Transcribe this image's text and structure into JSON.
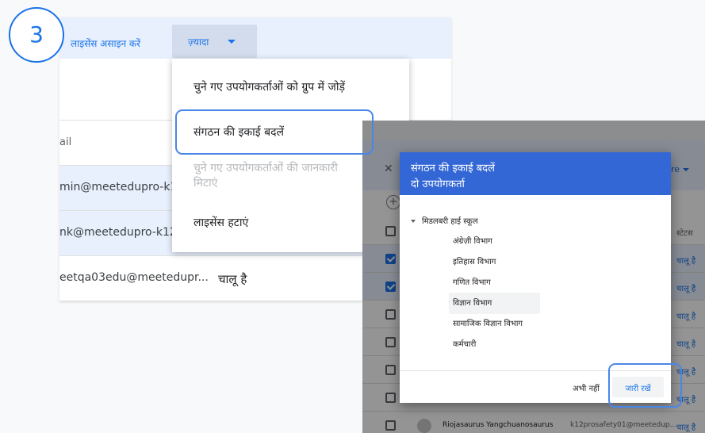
{
  "step": {
    "number": "3"
  },
  "toolbar": {
    "assign_license": "लाइसेंस असाइन करें",
    "more_label": "ज़्यादा"
  },
  "table": {
    "header_email": "ail",
    "rows": [
      {
        "email": "min@meetedupro-k12",
        "status": "",
        "selected": true
      },
      {
        "email": "nk@meetedupro-k12-",
        "status": "",
        "selected": true
      },
      {
        "email": "eetqa03edu@meetedupr...",
        "status": "चालू है",
        "selected": false
      }
    ]
  },
  "more_menu": {
    "items": [
      {
        "label": "चुने गए उपयोगकर्ताओं को ग्रुप में जोड़ें",
        "enabled": true
      },
      {
        "label": "संगठन की इकाई बदलें",
        "enabled": true
      },
      {
        "label": "चुने गए उपयोगकर्ताओं की जानकारी मिटाएं",
        "enabled": false
      },
      {
        "label": "लाइसेंस हटाएं",
        "enabled": true
      }
    ]
  },
  "background_table": {
    "more_partial": "re",
    "status_header": "स्टेटस",
    "rows": [
      {
        "checked": true,
        "status": "चालू है"
      },
      {
        "checked": true,
        "status": "चालू है"
      },
      {
        "checked": false,
        "status": "चालू है"
      },
      {
        "checked": false,
        "status": "चालू है"
      },
      {
        "checked": false,
        "status": "चालू है"
      },
      {
        "checked": false,
        "status": "चालू है"
      },
      {
        "checked": false,
        "status": "चालू है",
        "name": "Riojasaurus Yangchuanosaurus",
        "email": "k12prosafety01@meetedup..."
      }
    ]
  },
  "dialog": {
    "title": "संगठन की इकाई बदलें",
    "subtitle": "दो उपयोगकर्ता",
    "root_unit": "मिडलबरी हाई स्कूल",
    "units": [
      "अंग्रेज़ी विभाग",
      "इतिहास विभाग",
      "गणित विभाग",
      "विज्ञान विभाग",
      "सामाजिक विज्ञान विभाग",
      "कर्मचारी"
    ],
    "selected_unit_index": 3,
    "cancel_label": "अभी नहीं",
    "continue_label": "जारी रखें"
  },
  "colors": {
    "accent": "#1a73e8",
    "header_blue": "#3367d6",
    "highlight_ring": "#4a86e8",
    "selection_bg": "#e8f0fe"
  },
  "icons": {
    "more_caret": "caret-down-icon",
    "close": "close-icon",
    "add": "add-icon",
    "tree_caret": "caret-down-icon",
    "checkbox": "checkbox-icon"
  }
}
